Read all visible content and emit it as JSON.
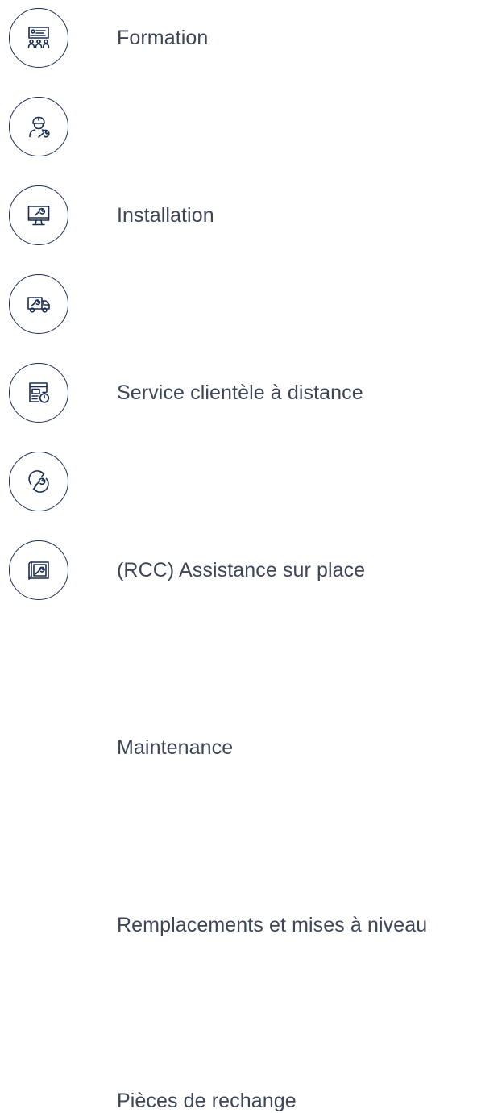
{
  "accent_color": "#1c2d52",
  "text_color": "#3d4558",
  "services": [
    {
      "label": "Formation",
      "icon": "training-presentation-icon"
    },
    {
      "label": "Installation",
      "icon": "technician-wrench-icon"
    },
    {
      "label": "Service clientèle à distance",
      "icon": "monitor-wrench-icon"
    },
    {
      "label": "(RCC) Assistance sur place",
      "icon": "service-truck-icon"
    },
    {
      "label": "Maintenance",
      "icon": "document-stopwatch-icon"
    },
    {
      "label": "Remplacements et mises à niveau",
      "icon": "cycle-wrench-icon"
    },
    {
      "label": "Pièces de rechange",
      "icon": "blueprint-wrench-icon"
    }
  ]
}
